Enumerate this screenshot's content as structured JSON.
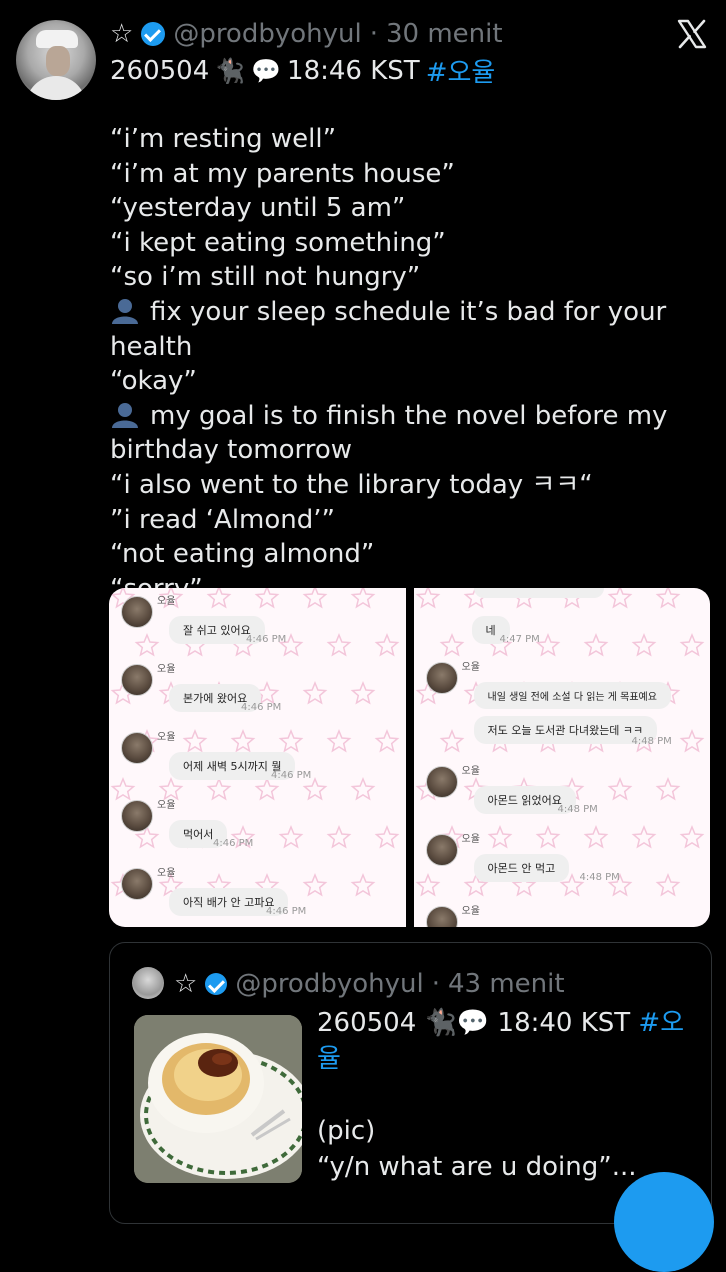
{
  "tweet": {
    "handle": "@prodbyohyul",
    "separator": "·",
    "timeago": "30 menit",
    "first_line": {
      "date": "260504",
      "cat_emoji": "🐈‍⬛",
      "bubble_emoji": "💬",
      "time": "18:46 KST",
      "hashtag": "#오율"
    },
    "lines": [
      "“i’m resting well”",
      "“i’m at my parents house”",
      "“yesterday until 5 am”",
      "“i kept eating something”",
      "“so i’m still not hungry”",
      "fix your sleep schedule it’s bad for your health",
      "“okay”",
      "my goal is to finish the novel before my",
      "birthday tomorrow",
      "“i also went to the library today ㅋㅋ“",
      "”i read ‘Almond’”",
      "“not eating almond”",
      "“sorry”"
    ]
  },
  "media": {
    "left_panel": [
      {
        "name": "오율",
        "text": "잘 쉬고 있어요",
        "time": "4:46 PM"
      },
      {
        "name": "오율",
        "text": "본가에 왔어요",
        "time": "4:46 PM"
      },
      {
        "name": "오율",
        "text": "어제 새벽 5시까지 뭘",
        "time": "4:46 PM"
      },
      {
        "name": "오율",
        "text": "먹어서",
        "time": "4:46 PM"
      },
      {
        "name": "오율",
        "text": "아직 배가 안 고파요",
        "time": "4:46 PM"
      }
    ],
    "right_panel": {
      "top_reply": {
        "text": "네",
        "time": "4:47 PM"
      },
      "messages": [
        {
          "name": "오율",
          "text": "내일 생일 전에 소설 다 읽는 게 목표예요",
          "text2": "저도 오늘 도서관 다녀왔는데 ㅋㅋ",
          "time": "4:48 PM"
        },
        {
          "name": "오율",
          "text": "아몬드 읽었어요",
          "time": "4:48 PM"
        },
        {
          "name": "오율",
          "text": "아몬드 안 먹고",
          "time": "4:48 PM"
        },
        {
          "name": "오율",
          "text": "",
          "time": ""
        }
      ]
    }
  },
  "quote": {
    "handle": "@prodbyohyul",
    "separator": "·",
    "timeago": "43 menit",
    "line1": "260504 🐈‍⬛💬 18:40 KST ",
    "hashtag_part1": "#오",
    "hashtag_part2": "율",
    "pic": "(pic)",
    "snippet": "“y/n what are u doing”..."
  },
  "colors": {
    "background": "#000000",
    "text": "#e7e9ea",
    "muted": "#71767b",
    "accent": "#1d9bf0",
    "border": "#2f3336"
  },
  "icons": [
    "star-icon",
    "verified-icon",
    "x-logo-icon",
    "person-icon",
    "compose-fab"
  ]
}
